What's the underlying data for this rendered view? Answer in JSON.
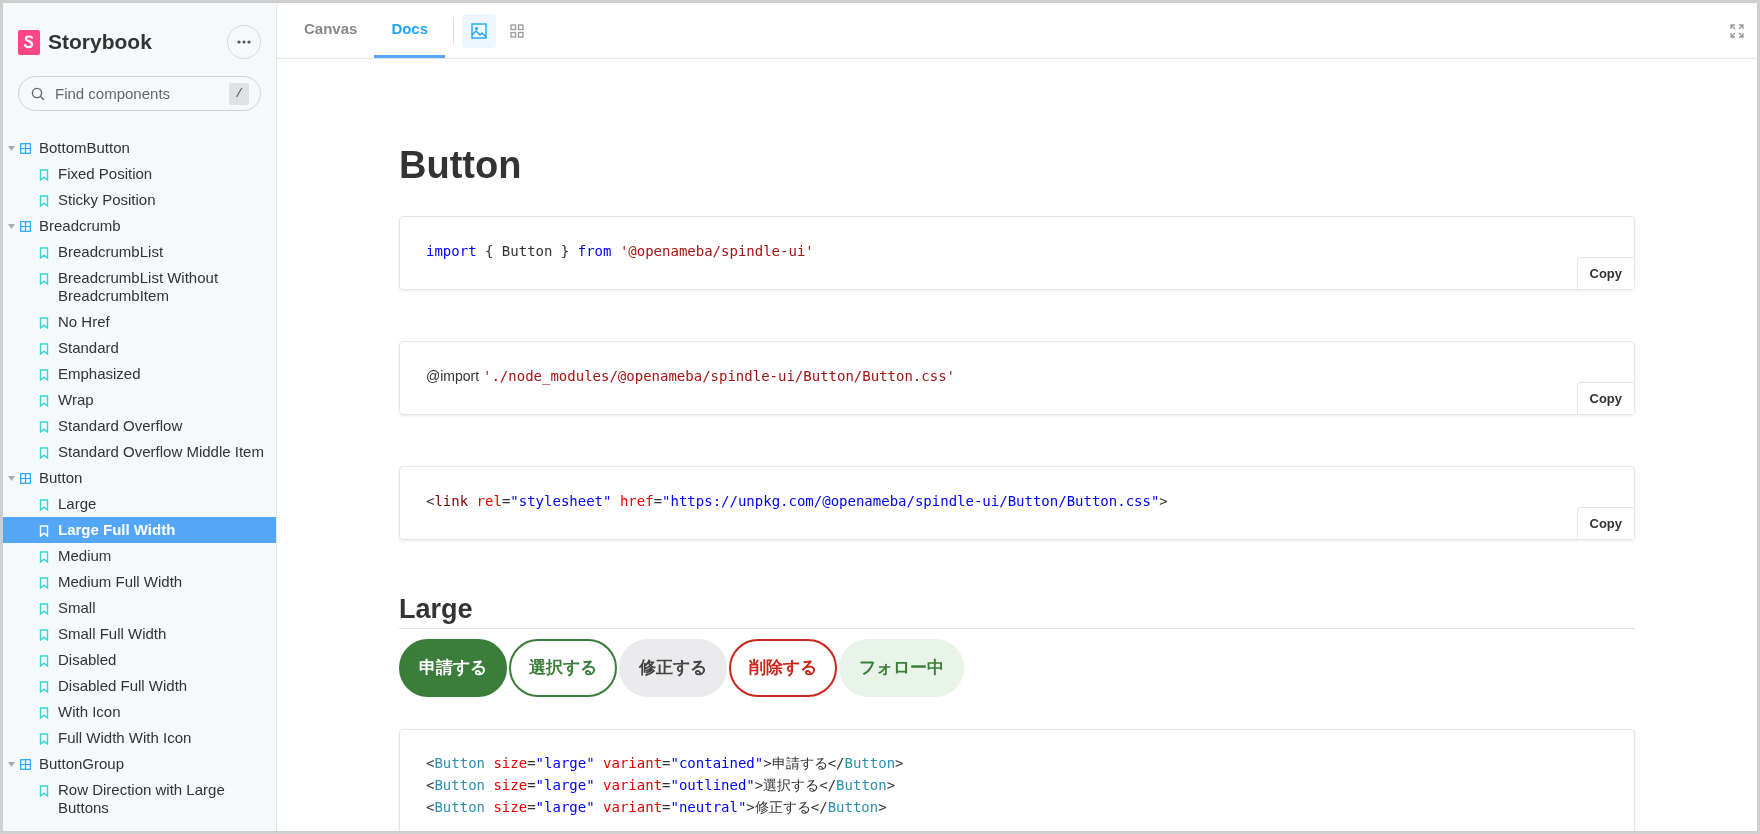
{
  "sidebar": {
    "brand": "Storybook",
    "search": {
      "placeholder": "Find components",
      "shortcut": "/"
    },
    "tree": [
      {
        "label": "BottomButton",
        "expanded": true,
        "children": [
          {
            "label": "Fixed Position",
            "selected": false
          },
          {
            "label": "Sticky Position",
            "selected": false
          }
        ]
      },
      {
        "label": "Breadcrumb",
        "expanded": true,
        "children": [
          {
            "label": "BreadcrumbList",
            "selected": false
          },
          {
            "label": "BreadcrumbList Without BreadcrumbItem",
            "selected": false
          },
          {
            "label": "No Href",
            "selected": false
          },
          {
            "label": "Standard",
            "selected": false
          },
          {
            "label": "Emphasized",
            "selected": false
          },
          {
            "label": "Wrap",
            "selected": false
          },
          {
            "label": "Standard Overflow",
            "selected": false
          },
          {
            "label": "Standard Overflow Middle Item",
            "selected": false
          }
        ]
      },
      {
        "label": "Button",
        "expanded": true,
        "children": [
          {
            "label": "Large",
            "selected": false
          },
          {
            "label": "Large Full Width",
            "selected": true
          },
          {
            "label": "Medium",
            "selected": false
          },
          {
            "label": "Medium Full Width",
            "selected": false
          },
          {
            "label": "Small",
            "selected": false
          },
          {
            "label": "Small Full Width",
            "selected": false
          },
          {
            "label": "Disabled",
            "selected": false
          },
          {
            "label": "Disabled Full Width",
            "selected": false
          },
          {
            "label": "With Icon",
            "selected": false
          },
          {
            "label": "Full Width With Icon",
            "selected": false
          }
        ]
      },
      {
        "label": "ButtonGroup",
        "expanded": true,
        "children": [
          {
            "label": "Row Direction with Large Buttons",
            "selected": false
          }
        ]
      }
    ]
  },
  "toolbar": {
    "tabs": [
      {
        "label": "Canvas",
        "selected": false
      },
      {
        "label": "Docs",
        "selected": true
      }
    ]
  },
  "docs": {
    "title": "Button",
    "code_blocks": [
      {
        "copy": "Copy",
        "lines": [
          [
            {
              "kind": "keyword",
              "text": "import"
            },
            {
              "kind": "plain",
              "text": " { Button } "
            },
            {
              "kind": "keyword",
              "text": "from"
            },
            {
              "kind": "string",
              "text": " '@openameba/spindle-ui'"
            }
          ]
        ]
      },
      {
        "copy": "Copy",
        "lines": [
          [
            {
              "kind": "prose",
              "text": "@import "
            },
            {
              "kind": "string",
              "text": "'./node_modules/@openameba/spindle-ui/Button/Button.css'"
            }
          ]
        ]
      },
      {
        "copy": "Copy",
        "lines": [
          [
            {
              "kind": "plain",
              "text": "<"
            },
            {
              "kind": "tag",
              "text": "link"
            },
            {
              "kind": "attr",
              "text": " rel"
            },
            {
              "kind": "plain",
              "text": "="
            },
            {
              "kind": "value",
              "text": "\"stylesheet\""
            },
            {
              "kind": "attr",
              "text": " href"
            },
            {
              "kind": "plain",
              "text": "="
            },
            {
              "kind": "value",
              "text": "\"https://unpkg.com/@openameba/spindle-ui/Button/Button.css\""
            },
            {
              "kind": "plain",
              "text": ">"
            }
          ]
        ]
      }
    ],
    "section": {
      "heading": "Large",
      "buttons": [
        {
          "label": "申請する",
          "kind": "contained"
        },
        {
          "label": "選択する",
          "kind": "outlined"
        },
        {
          "label": "修正する",
          "kind": "neutral"
        },
        {
          "label": "削除する",
          "kind": "danger"
        },
        {
          "label": "フォロー中",
          "kind": "lighted"
        }
      ],
      "code": {
        "lines": [
          [
            {
              "kind": "plain",
              "text": "<"
            },
            {
              "kind": "component",
              "text": "Button"
            },
            {
              "kind": "attr",
              "text": " size"
            },
            {
              "kind": "plain",
              "text": "="
            },
            {
              "kind": "value",
              "text": "\"large\""
            },
            {
              "kind": "attr",
              "text": " variant"
            },
            {
              "kind": "plain",
              "text": "="
            },
            {
              "kind": "value",
              "text": "\"contained\""
            },
            {
              "kind": "plain",
              "text": ">申請する</"
            },
            {
              "kind": "component",
              "text": "Button"
            },
            {
              "kind": "plain",
              "text": ">"
            }
          ],
          [
            {
              "kind": "plain",
              "text": "<"
            },
            {
              "kind": "component",
              "text": "Button"
            },
            {
              "kind": "attr",
              "text": " size"
            },
            {
              "kind": "plain",
              "text": "="
            },
            {
              "kind": "value",
              "text": "\"large\""
            },
            {
              "kind": "attr",
              "text": " variant"
            },
            {
              "kind": "plain",
              "text": "="
            },
            {
              "kind": "value",
              "text": "\"outlined\""
            },
            {
              "kind": "plain",
              "text": ">選択する</"
            },
            {
              "kind": "component",
              "text": "Button"
            },
            {
              "kind": "plain",
              "text": ">"
            }
          ],
          [
            {
              "kind": "plain",
              "text": "<"
            },
            {
              "kind": "component",
              "text": "Button"
            },
            {
              "kind": "attr",
              "text": " size"
            },
            {
              "kind": "plain",
              "text": "="
            },
            {
              "kind": "value",
              "text": "\"large\""
            },
            {
              "kind": "attr",
              "text": " variant"
            },
            {
              "kind": "plain",
              "text": "="
            },
            {
              "kind": "value",
              "text": "\"neutral\""
            },
            {
              "kind": "plain",
              "text": ">修正する</"
            },
            {
              "kind": "component",
              "text": "Button"
            },
            {
              "kind": "plain",
              "text": ">"
            }
          ]
        ]
      }
    }
  }
}
